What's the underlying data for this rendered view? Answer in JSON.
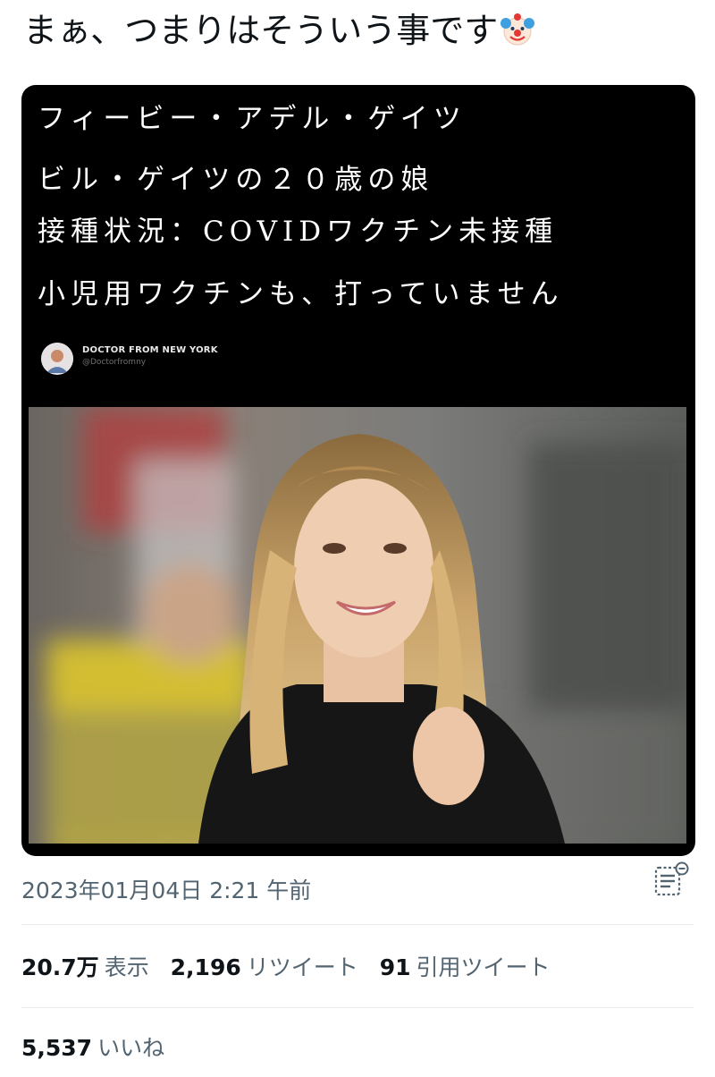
{
  "tweet": {
    "text": "まぁ、つまりはそういう事です",
    "emoji_icon": "clown-face-icon"
  },
  "media": {
    "overlay_lines": [
      "フィービー・アデル・ゲイツ",
      "ビル・ゲイツの２０歳の娘",
      "接種状況：COVIDワクチン未接種",
      "小児用ワクチンも、打っていません"
    ],
    "source_name": "DOCTOR FROM NEW YORK",
    "source_handle": "@Doctorfromny"
  },
  "meta": {
    "timestamp": "2023年01月04日 2:21 午前",
    "analytics_icon": "analytics-icon"
  },
  "stats": {
    "views_count": "20.7万",
    "views_label": "表示",
    "retweets_count": "2,196",
    "retweets_label": "リツイート",
    "quotes_count": "91",
    "quotes_label": "引用ツイート",
    "likes_count": "5,537",
    "likes_label": "いいね"
  }
}
